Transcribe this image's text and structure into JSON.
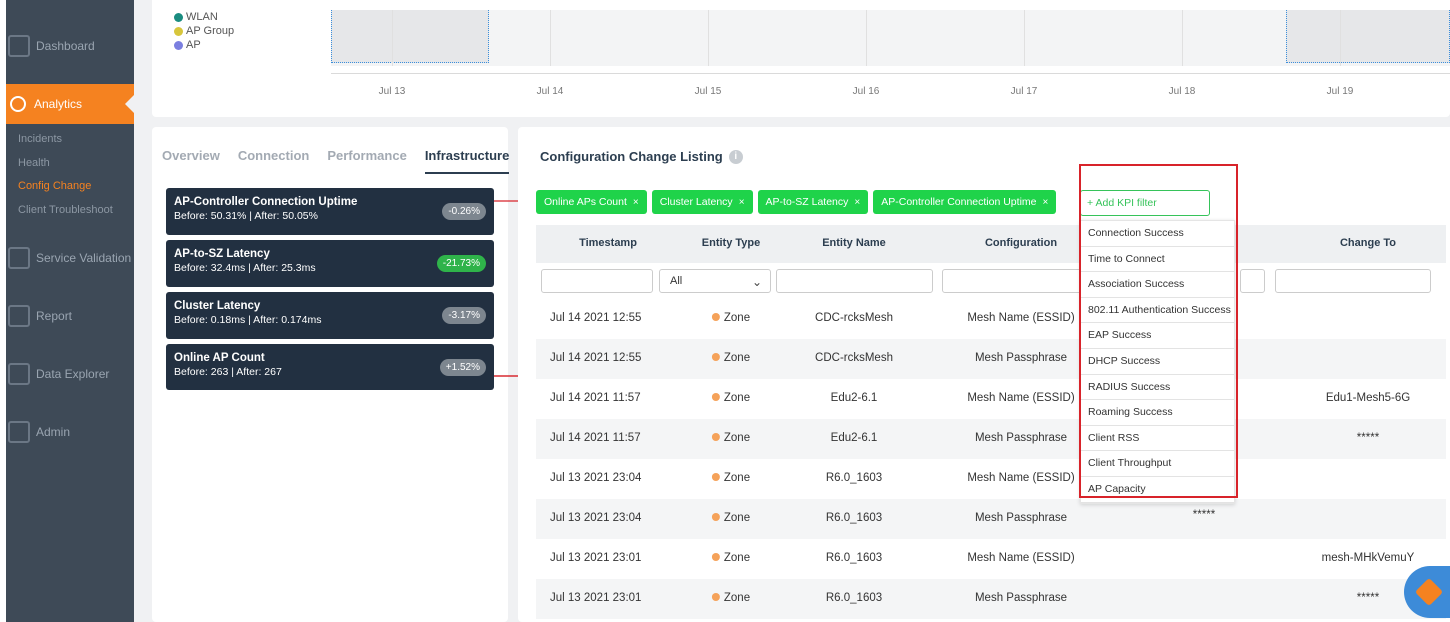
{
  "sidebar": {
    "items": [
      {
        "label": "Dashboard",
        "icon": "dashboard-icon"
      },
      {
        "label": "Analytics",
        "icon": "analytics-icon",
        "active": true
      },
      {
        "label": "Service Validation",
        "icon": "shield-icon"
      },
      {
        "label": "Report",
        "icon": "report-icon"
      },
      {
        "label": "Data Explorer",
        "icon": "cube-icon"
      },
      {
        "label": "Admin",
        "icon": "eye-icon"
      }
    ],
    "sub_items": [
      "Incidents",
      "Health",
      "Config Change",
      "Client Troubleshoot"
    ],
    "selected_sub": "Config Change"
  },
  "timeline": {
    "legend": [
      {
        "label": "WLAN",
        "color": "#1a8c80"
      },
      {
        "label": "AP Group",
        "color": "#d7c63c"
      },
      {
        "label": "AP",
        "color": "#7b7fe0"
      }
    ],
    "ticks": [
      "Jul 13",
      "Jul 14",
      "Jul 15",
      "Jul 16",
      "Jul 17",
      "Jul 18",
      "Jul 19"
    ]
  },
  "left_panel": {
    "tabs": [
      "Overview",
      "Connection",
      "Performance",
      "Infrastructure"
    ],
    "active_tab": "Infrastructure",
    "kpis": [
      {
        "title": "AP-Controller Connection Uptime",
        "detail": "Before: 50.31% | After: 50.05%",
        "change": "-0.26%",
        "tone": "grey"
      },
      {
        "title": "AP-to-SZ Latency",
        "detail": "Before: 32.4ms | After: 25.3ms",
        "change": "-21.73%",
        "tone": "green"
      },
      {
        "title": "Cluster Latency",
        "detail": "Before: 0.18ms | After: 0.174ms",
        "change": "-3.17%",
        "tone": "grey"
      },
      {
        "title": "Online AP Count",
        "detail": "Before: 263 | After: 267",
        "change": "+1.52%",
        "tone": "grey"
      }
    ]
  },
  "right_panel": {
    "title": "Configuration Change Listing",
    "chips": [
      "Online APs Count",
      "Cluster Latency",
      "AP-to-SZ Latency",
      "AP-Controller Connection Uptime"
    ],
    "chip_close": "×",
    "add_filter_placeholder": "+ Add KPI filter",
    "columns": [
      "Timestamp",
      "Entity Type",
      "Entity Name",
      "Configuration",
      "Change To"
    ],
    "entity_filter_value": "All",
    "rows": [
      {
        "timestamp": "Jul 14 2021 12:55",
        "entity_type": "Zone",
        "entity_name": "CDC-rcksMesh",
        "configuration": "Mesh Name (ESSID)",
        "change_from": "",
        "change_to": ""
      },
      {
        "timestamp": "Jul 14 2021 12:55",
        "entity_type": "Zone",
        "entity_name": "CDC-rcksMesh",
        "configuration": "Mesh Passphrase",
        "change_from": "",
        "change_to": ""
      },
      {
        "timestamp": "Jul 14 2021 11:57",
        "entity_type": "Zone",
        "entity_name": "Edu2-6.1",
        "configuration": "Mesh Name (ESSID)",
        "change_from": "",
        "change_to": "Edu1-Mesh5-6G"
      },
      {
        "timestamp": "Jul 14 2021 11:57",
        "entity_type": "Zone",
        "entity_name": "Edu2-6.1",
        "configuration": "Mesh Passphrase",
        "change_from": "",
        "change_to": "*****"
      },
      {
        "timestamp": "Jul 13 2021 23:04",
        "entity_type": "Zone",
        "entity_name": "R6.0_1603",
        "configuration": "Mesh Name (ESSID)",
        "change_from": "",
        "change_to": ""
      },
      {
        "timestamp": "Jul 13 2021 23:04",
        "entity_type": "Zone",
        "entity_name": "R6.0_1603",
        "configuration": "Mesh Passphrase",
        "change_from": "*****",
        "change_to": ""
      },
      {
        "timestamp": "Jul 13 2021 23:01",
        "entity_type": "Zone",
        "entity_name": "R6.0_1603",
        "configuration": "Mesh Name (ESSID)",
        "change_from": "",
        "change_to": "mesh-MHkVemuY"
      },
      {
        "timestamp": "Jul 13 2021 23:01",
        "entity_type": "Zone",
        "entity_name": "R6.0_1603",
        "configuration": "Mesh Passphrase",
        "change_from": "",
        "change_to": "*****"
      }
    ],
    "kpi_dropdown": [
      "Connection Success",
      "Time to Connect",
      "Association Success",
      "802.11 Authentication Success",
      "EAP Success",
      "DHCP Success",
      "RADIUS Success",
      "Roaming Success",
      "Client RSS",
      "Client Throughput",
      "AP Capacity"
    ]
  },
  "colors": {
    "accent": "#f58220",
    "chip_green": "#1fd34a",
    "kpi_card": "#223041",
    "highlight": "#d8232a"
  }
}
